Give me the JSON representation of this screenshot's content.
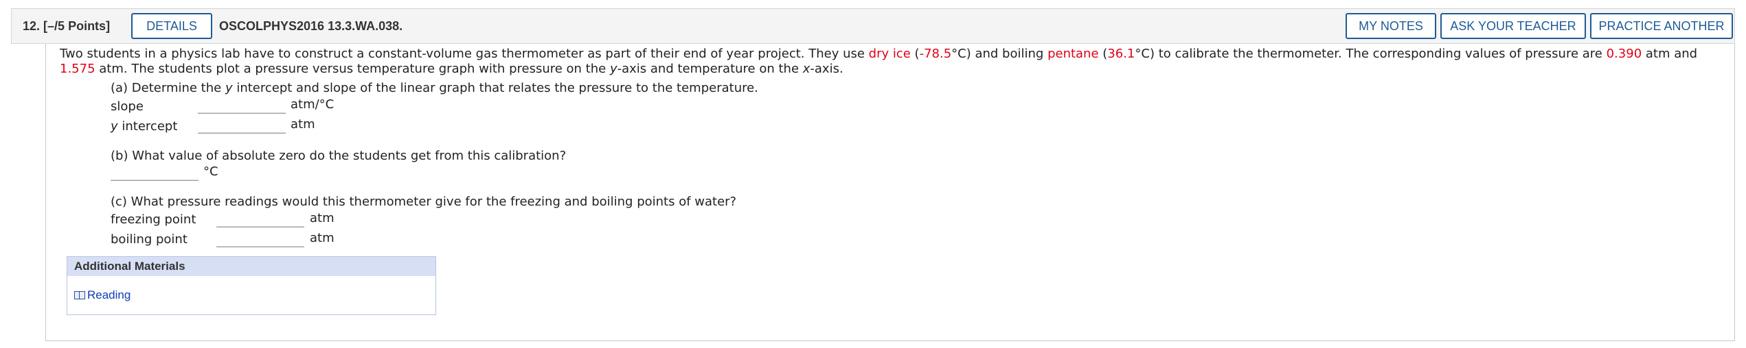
{
  "header": {
    "question_number": "12.",
    "points": "[–/5 Points]",
    "details_label": "DETAILS",
    "question_code": "OSCOLPHYS2016 13.3.WA.038.",
    "my_notes_label": "MY NOTES",
    "ask_teacher_label": "ASK YOUR TEACHER",
    "practice_label": "PRACTICE ANOTHER"
  },
  "problem": {
    "p1": "Two students in a physics lab have to construct a constant-volume gas thermometer as part of their end of year project. They use ",
    "dry_ice": "dry ice",
    "p2": " (",
    "dry_ice_temp": "-78.5",
    "p3": "°C) and boiling ",
    "pentane": "pentane",
    "p4": " (",
    "pentane_temp": "36.1",
    "p5": "°C) to calibrate the thermometer. The corresponding values of pressure are ",
    "pressure1": "0.390",
    "p6": " atm and ",
    "pressure2": "1.575",
    "p7": " atm. The students plot a pressure versus temperature graph with pressure on the ",
    "y_italic": "y",
    "p8": "-axis and temperature on the ",
    "x_italic": "x",
    "p9": "-axis."
  },
  "part_a": {
    "prompt_1": "(a) Determine the ",
    "prompt_y": "y",
    "prompt_2": " intercept and slope of the linear graph that relates the pressure to the temperature.",
    "slope_label": "slope",
    "slope_unit": "atm/°C",
    "yint_label_y": "y",
    "yint_label_rest": " intercept",
    "yint_unit": "atm"
  },
  "part_b": {
    "prompt": "(b) What value of absolute zero do the students get from this calibration?",
    "unit": "°C"
  },
  "part_c": {
    "prompt": "(c) What pressure readings would this thermometer give for the freezing and boiling points of water?",
    "freezing_label": "freezing point",
    "freezing_unit": "atm",
    "boiling_label": "boiling point",
    "boiling_unit": "atm"
  },
  "additional_materials": {
    "title": "Additional Materials",
    "reading_label": "Reading"
  }
}
